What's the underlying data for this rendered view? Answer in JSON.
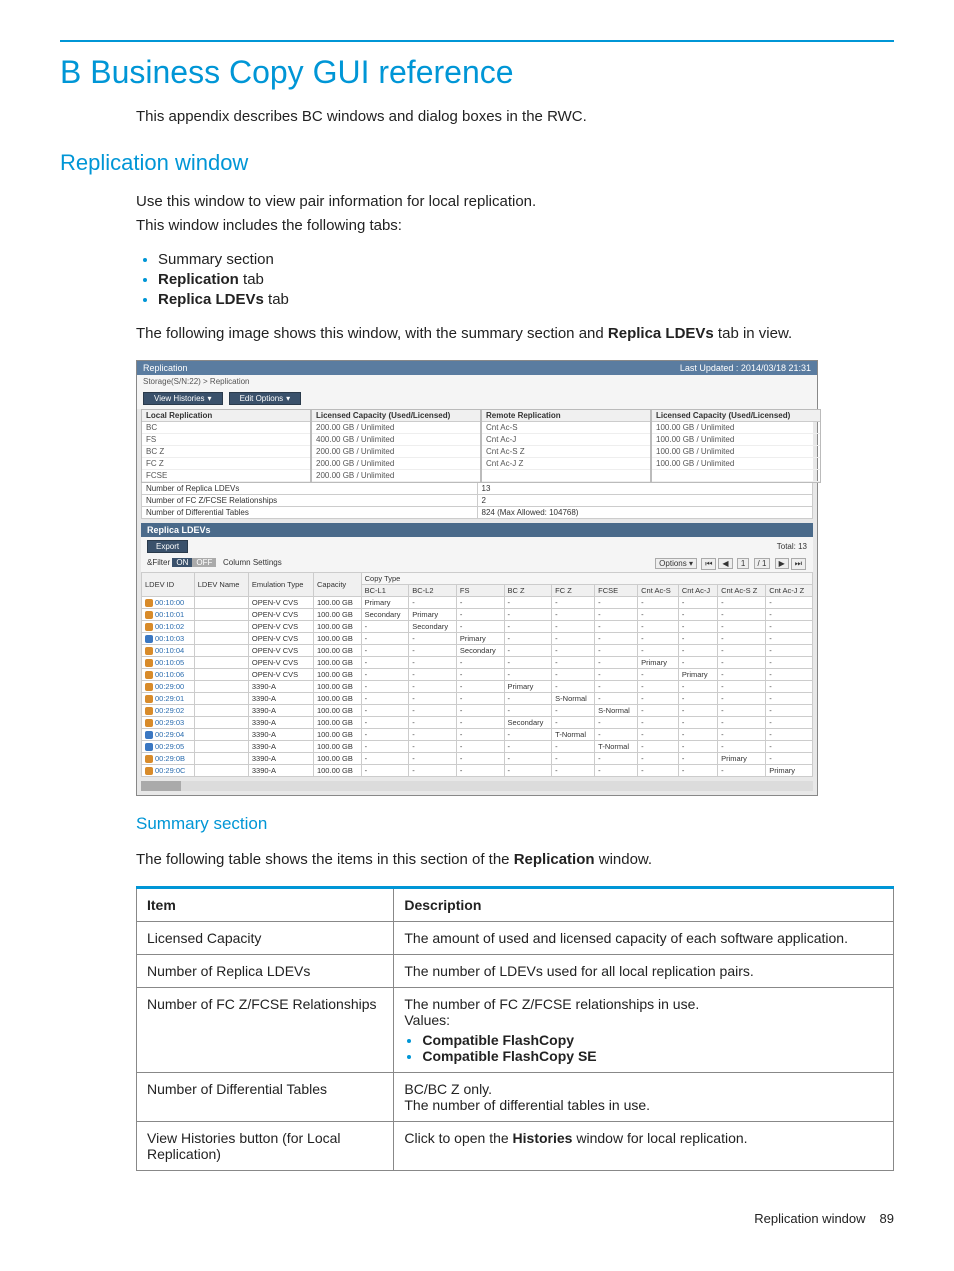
{
  "page_title": "B Business Copy GUI reference",
  "intro": "This appendix describes BC windows and dialog boxes in the RWC.",
  "section_rep_window": "Replication window",
  "rep_window_p1": "Use this window to view pair information for local replication.",
  "rep_window_p2": "This window includes the following tabs:",
  "tabs_bullets": {
    "b1": "Summary section",
    "b2_pre": "Replication",
    "b2_post": " tab",
    "b3_pre": "Replica LDEVs",
    "b3_post": " tab"
  },
  "image_caption_pre": "The following image shows this window, with the summary section and ",
  "image_caption_bold": "Replica LDEVs",
  "image_caption_post": " tab in view.",
  "screenshot": {
    "window_title": "Replication",
    "last_updated": "Last Updated : 2014/03/18 21:31",
    "breadcrumbs": "Storage(S/N:22) > Replication",
    "view_histories_btn": "View Histories",
    "edit_options_btn": "Edit Options",
    "local_rep_header": "Local Replication",
    "local_cap_header": "Licensed Capacity (Used/Licensed)",
    "remote_rep_header": "Remote Replication",
    "remote_cap_header": "Licensed Capacity (Used/Licensed)",
    "local_rows": [
      {
        "k": "BC",
        "v": "200.00 GB / Unlimited"
      },
      {
        "k": "FS",
        "v": "400.00 GB / Unlimited"
      },
      {
        "k": "BC Z",
        "v": "200.00 GB / Unlimited"
      },
      {
        "k": "FC Z",
        "v": "200.00 GB / Unlimited"
      },
      {
        "k": "FCSE",
        "v": "200.00 GB / Unlimited"
      }
    ],
    "remote_rows": [
      {
        "k": "Cnt Ac-S",
        "v": "100.00 GB / Unlimited"
      },
      {
        "k": "Cnt Ac-J",
        "v": "100.00 GB / Unlimited"
      },
      {
        "k": "Cnt Ac-S Z",
        "v": "100.00 GB / Unlimited"
      },
      {
        "k": "Cnt Ac-J Z",
        "v": "100.00 GB / Unlimited"
      }
    ],
    "num_replica_label": "Number of Replica LDEVs",
    "num_replica_val": "13",
    "num_fc_label": "Number of FC Z/FCSE Relationships",
    "num_fc_val": "2",
    "num_diff_label": "Number of Differential Tables",
    "num_diff_val": "824 (Max Allowed: 104768)",
    "tab_label": "Replica LDEVs",
    "export_btn": "Export",
    "total_label": "Total: 13",
    "filter_label": "&Filter",
    "filter_on": "ON",
    "filter_off": "OFF",
    "col_settings": "Column Settings",
    "options_label": "Options ▾",
    "page_cur": "1",
    "page_total": "/ 1",
    "table_headers": {
      "ldev_id": "LDEV ID",
      "ldev_name": "LDEV Name",
      "emu_type": "Emulation Type",
      "capacity": "Capacity",
      "copy_type": "Copy Type",
      "bc_l1": "BC-L1",
      "bc_l2": "BC-L2",
      "fs_h": "FS",
      "bc_z": "BC Z",
      "fc_z": "FC Z",
      "fcse": "FCSE",
      "cnt_acs": "Cnt Ac-S",
      "cnt_acj": "Cnt Ac-J",
      "cnt_acsz": "Cnt Ac-S Z",
      "cnt_acjz": "Cnt Ac-J Z"
    },
    "rows": [
      {
        "icon": "orange",
        "id": "00:10:00",
        "emu": "OPEN-V CVS",
        "cap": "100.00 GB",
        "bcl1": "Primary",
        "bcl2": "-",
        "fs": "-",
        "bcz": "-",
        "fcz": "-",
        "fcse": "-",
        "acs": "-",
        "acj": "-",
        "acsz": "-",
        "acjz": "-"
      },
      {
        "icon": "orange",
        "id": "00:10:01",
        "emu": "OPEN-V CVS",
        "cap": "100.00 GB",
        "bcl1": "Secondary",
        "bcl2": "Primary",
        "fs": "-",
        "bcz": "-",
        "fcz": "-",
        "fcse": "-",
        "acs": "-",
        "acj": "-",
        "acsz": "-",
        "acjz": "-"
      },
      {
        "icon": "orange",
        "id": "00:10:02",
        "emu": "OPEN-V CVS",
        "cap": "100.00 GB",
        "bcl1": "-",
        "bcl2": "Secondary",
        "fs": "-",
        "bcz": "-",
        "fcz": "-",
        "fcse": "-",
        "acs": "-",
        "acj": "-",
        "acsz": "-",
        "acjz": "-"
      },
      {
        "icon": "blue",
        "id": "00:10:03",
        "emu": "OPEN-V CVS",
        "cap": "100.00 GB",
        "bcl1": "-",
        "bcl2": "-",
        "fs": "Primary",
        "bcz": "-",
        "fcz": "-",
        "fcse": "-",
        "acs": "-",
        "acj": "-",
        "acsz": "-",
        "acjz": "-"
      },
      {
        "icon": "orange",
        "id": "00:10:04",
        "emu": "OPEN-V CVS",
        "cap": "100.00 GB",
        "bcl1": "-",
        "bcl2": "-",
        "fs": "Secondary",
        "bcz": "-",
        "fcz": "-",
        "fcse": "-",
        "acs": "-",
        "acj": "-",
        "acsz": "-",
        "acjz": "-"
      },
      {
        "icon": "orange",
        "id": "00:10:05",
        "emu": "OPEN-V CVS",
        "cap": "100.00 GB",
        "bcl1": "-",
        "bcl2": "-",
        "fs": "-",
        "bcz": "-",
        "fcz": "-",
        "fcse": "-",
        "acs": "Primary",
        "acj": "-",
        "acsz": "-",
        "acjz": "-"
      },
      {
        "icon": "orange",
        "id": "00:10:06",
        "emu": "OPEN-V CVS",
        "cap": "100.00 GB",
        "bcl1": "-",
        "bcl2": "-",
        "fs": "-",
        "bcz": "-",
        "fcz": "-",
        "fcse": "-",
        "acs": "-",
        "acj": "Primary",
        "acsz": "-",
        "acjz": "-"
      },
      {
        "icon": "orange",
        "id": "00:29:00",
        "emu": "3390-A",
        "cap": "100.00 GB",
        "bcl1": "-",
        "bcl2": "-",
        "fs": "-",
        "bcz": "Primary",
        "fcz": "-",
        "fcse": "-",
        "acs": "-",
        "acj": "-",
        "acsz": "-",
        "acjz": "-"
      },
      {
        "icon": "orange",
        "id": "00:29:01",
        "emu": "3390-A",
        "cap": "100.00 GB",
        "bcl1": "-",
        "bcl2": "-",
        "fs": "-",
        "bcz": "-",
        "fcz": "S-Normal",
        "fcse": "-",
        "acs": "-",
        "acj": "-",
        "acsz": "-",
        "acjz": "-"
      },
      {
        "icon": "orange",
        "id": "00:29:02",
        "emu": "3390-A",
        "cap": "100.00 GB",
        "bcl1": "-",
        "bcl2": "-",
        "fs": "-",
        "bcz": "-",
        "fcz": "-",
        "fcse": "S-Normal",
        "acs": "-",
        "acj": "-",
        "acsz": "-",
        "acjz": "-"
      },
      {
        "icon": "orange",
        "id": "00:29:03",
        "emu": "3390-A",
        "cap": "100.00 GB",
        "bcl1": "-",
        "bcl2": "-",
        "fs": "-",
        "bcz": "Secondary",
        "fcz": "-",
        "fcse": "-",
        "acs": "-",
        "acj": "-",
        "acsz": "-",
        "acjz": "-"
      },
      {
        "icon": "blue",
        "id": "00:29:04",
        "emu": "3390-A",
        "cap": "100.00 GB",
        "bcl1": "-",
        "bcl2": "-",
        "fs": "-",
        "bcz": "-",
        "fcz": "T-Normal",
        "fcse": "-",
        "acs": "-",
        "acj": "-",
        "acsz": "-",
        "acjz": "-"
      },
      {
        "icon": "blue",
        "id": "00:29:05",
        "emu": "3390-A",
        "cap": "100.00 GB",
        "bcl1": "-",
        "bcl2": "-",
        "fs": "-",
        "bcz": "-",
        "fcz": "-",
        "fcse": "T-Normal",
        "acs": "-",
        "acj": "-",
        "acsz": "-",
        "acjz": "-"
      },
      {
        "icon": "orange",
        "id": "00:29:0B",
        "emu": "3390-A",
        "cap": "100.00 GB",
        "bcl1": "-",
        "bcl2": "-",
        "fs": "-",
        "bcz": "-",
        "fcz": "-",
        "fcse": "-",
        "acs": "-",
        "acj": "-",
        "acsz": "Primary",
        "acjz": "-"
      },
      {
        "icon": "orange",
        "id": "00:29:0C",
        "emu": "3390-A",
        "cap": "100.00 GB",
        "bcl1": "-",
        "bcl2": "-",
        "fs": "-",
        "bcz": "-",
        "fcz": "-",
        "fcse": "-",
        "acs": "-",
        "acj": "-",
        "acsz": "-",
        "acjz": "Primary"
      }
    ]
  },
  "summary_section_title": "Summary section",
  "summary_intro_pre": "The following table shows the items in this section of the ",
  "summary_intro_bold": "Replication",
  "summary_intro_post": " window.",
  "doc_table": {
    "h_item": "Item",
    "h_desc": "Description",
    "r1_item": "Licensed Capacity",
    "r1_desc": "The amount of used and licensed capacity of each software application.",
    "r2_item": "Number of Replica LDEVs",
    "r2_desc": "The number of LDEVs used for all local replication pairs.",
    "r3_item": "Number of FC Z/FCSE Relationships",
    "r3_desc_l1": "The number of FC Z/FCSE relationships in use.",
    "r3_desc_l2": "Values:",
    "r3_b1": "Compatible FlashCopy",
    "r3_b2": "Compatible FlashCopy SE",
    "r4_item": "Number of Differential Tables",
    "r4_desc_l1": "BC/BC Z only.",
    "r4_desc_l2": "The number of differential tables in use.",
    "r5_item": "View Histories button (for Local Replication)",
    "r5_desc_pre": "Click to open the ",
    "r5_desc_bold": "Histories",
    "r5_desc_post": " window for local replication."
  },
  "footer_left": "Replication window",
  "footer_right": "89"
}
